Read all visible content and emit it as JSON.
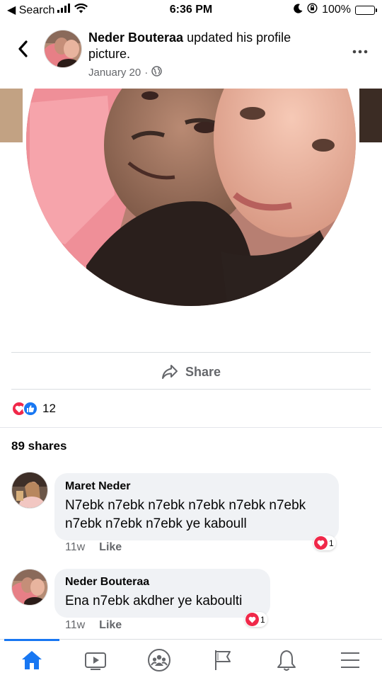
{
  "status_bar": {
    "back_app": "◀ Search",
    "time": "6:36 PM",
    "battery": "100%"
  },
  "post": {
    "author": "Neder Bouteraa",
    "action": "updated his profile picture.",
    "date": "January 20",
    "separator": "·",
    "privacy_icon": "globe-icon"
  },
  "actions": {
    "share_label": "Share"
  },
  "reactions": {
    "count": "12",
    "types": [
      "love",
      "like"
    ]
  },
  "shares": {
    "label": "89 shares"
  },
  "comments": [
    {
      "name": "Maret Neder",
      "text": "N7ebk n7ebk n7ebk n7ebk n7ebk n7ebk n7ebk n7ebk n7ebk ye kaboull",
      "time": "11w",
      "like_label": "Like",
      "reaction_count": "1"
    },
    {
      "name": "Neder Bouteraa",
      "text": "Ena n7ebk akdher ye kaboulti",
      "time": "11w",
      "like_label": "Like",
      "reaction_count": "1"
    }
  ],
  "tab_bar": {
    "tabs": [
      "home-icon",
      "video-icon",
      "groups-icon",
      "pages-flag-icon",
      "notifications-bell-icon",
      "menu-icon"
    ],
    "active": "home-icon"
  },
  "colors": {
    "accent": "#1877f2",
    "love": "#f02849",
    "bubble": "#f0f2f5",
    "secondary_text": "#65676b"
  }
}
